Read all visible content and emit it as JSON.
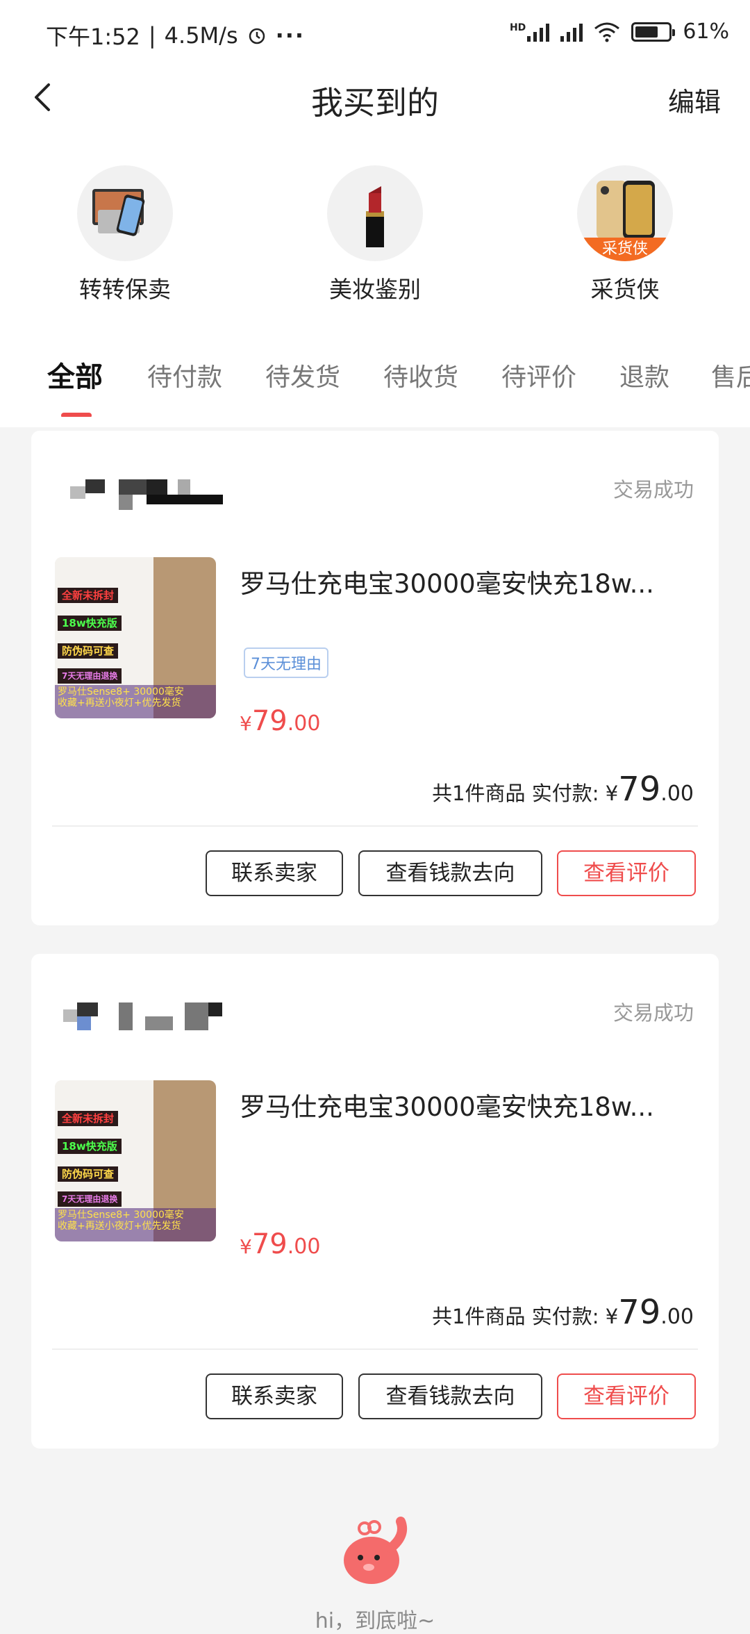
{
  "status_bar": {
    "time": "下午1:52",
    "speed": "4.5M/s",
    "battery": "61%",
    "network_label": "HD"
  },
  "header": {
    "title": "我买到的",
    "edit_label": "编辑"
  },
  "entries": [
    {
      "label": "转转保卖",
      "icon": "electronics-icon"
    },
    {
      "label": "美妆鉴别",
      "icon": "lipstick-icon"
    },
    {
      "label": "采货侠",
      "icon": "phone-icon",
      "badge": "采货侠"
    }
  ],
  "tabs": [
    "全部",
    "待付款",
    "待发货",
    "待收货",
    "待评价",
    "退款",
    "售后"
  ],
  "active_tab": "全部",
  "orders": [
    {
      "status": "交易成功",
      "product_name": "罗马仕充电宝30000毫安快充18w...",
      "policy_tag": "7天无理由",
      "price_symbol": "¥",
      "price_int": "79",
      "price_dec": ".00",
      "summary": "共1件商品 实付款:",
      "total_symbol": "¥",
      "total_int": "79",
      "total_dec": ".00",
      "buttons": [
        "联系卖家",
        "查看钱款去向",
        "查看评价"
      ]
    },
    {
      "status": "交易成功",
      "product_name": "罗马仕充电宝30000毫安快充18w...",
      "price_symbol": "¥",
      "price_int": "79",
      "price_dec": ".00",
      "summary": "共1件商品 实付款:",
      "total_symbol": "¥",
      "total_int": "79",
      "total_dec": ".00",
      "buttons": [
        "联系卖家",
        "查看钱款去向",
        "查看评价"
      ]
    }
  ],
  "thumbnail_tags": [
    "全新未拆封",
    "18w快充版",
    "防伪码可查",
    "7天无理由退换",
    "罗马仕Sense8+ 30000毫安",
    "收藏+再送小夜灯+优先发货"
  ],
  "footer": {
    "text": "hi，到底啦~"
  },
  "colors": {
    "accent": "#ef4c4c",
    "tag_blue": "#5b8fd8",
    "badge_orange": "#f36b22"
  }
}
